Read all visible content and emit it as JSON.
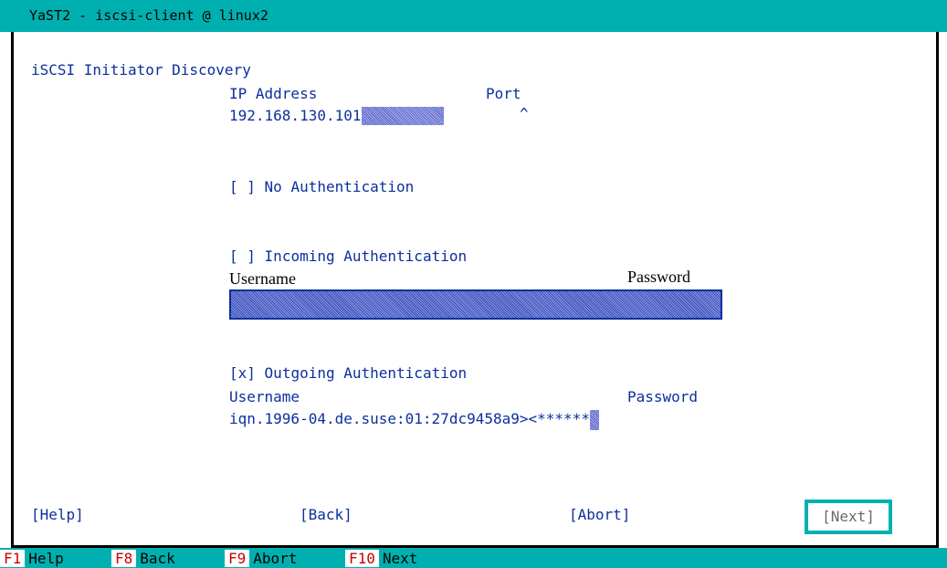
{
  "window": {
    "title": "YaST2 - iscsi-client @ linux2"
  },
  "page": {
    "heading": "iSCSI Initiator Discovery"
  },
  "discovery": {
    "ip_label": "IP Address",
    "port_label": "Port",
    "ip_value": "192.168.130.101",
    "port_value": "^"
  },
  "auth": {
    "no_auth": {
      "checkbox": "[ ]",
      "label": "No Authentication"
    },
    "incoming": {
      "checkbox": "[ ]",
      "label": "Incoming Authentication",
      "username_label": "Username",
      "password_label": "Password",
      "value": ""
    },
    "outgoing": {
      "checkbox": "[x]",
      "label": "Outgoing Authentication",
      "username_label": "Username",
      "password_label": "Password",
      "value": "iqn.1996-04.de.suse:01:27dc9458a9><******"
    }
  },
  "buttons": {
    "help": "[Help]",
    "back": "[Back]",
    "abort": "[Abort]",
    "next": "[Next]"
  },
  "fkeys": [
    {
      "key": "F1",
      "label": "Help"
    },
    {
      "key": "F8",
      "label": "Back"
    },
    {
      "key": "F9",
      "label": "Abort"
    },
    {
      "key": "F10",
      "label": "Next"
    }
  ],
  "colors": {
    "terminal_bg": "#ffffff",
    "title_bar": "#00b0b0",
    "text": "#0c2f9e",
    "focus_border": "#00b0b0"
  }
}
